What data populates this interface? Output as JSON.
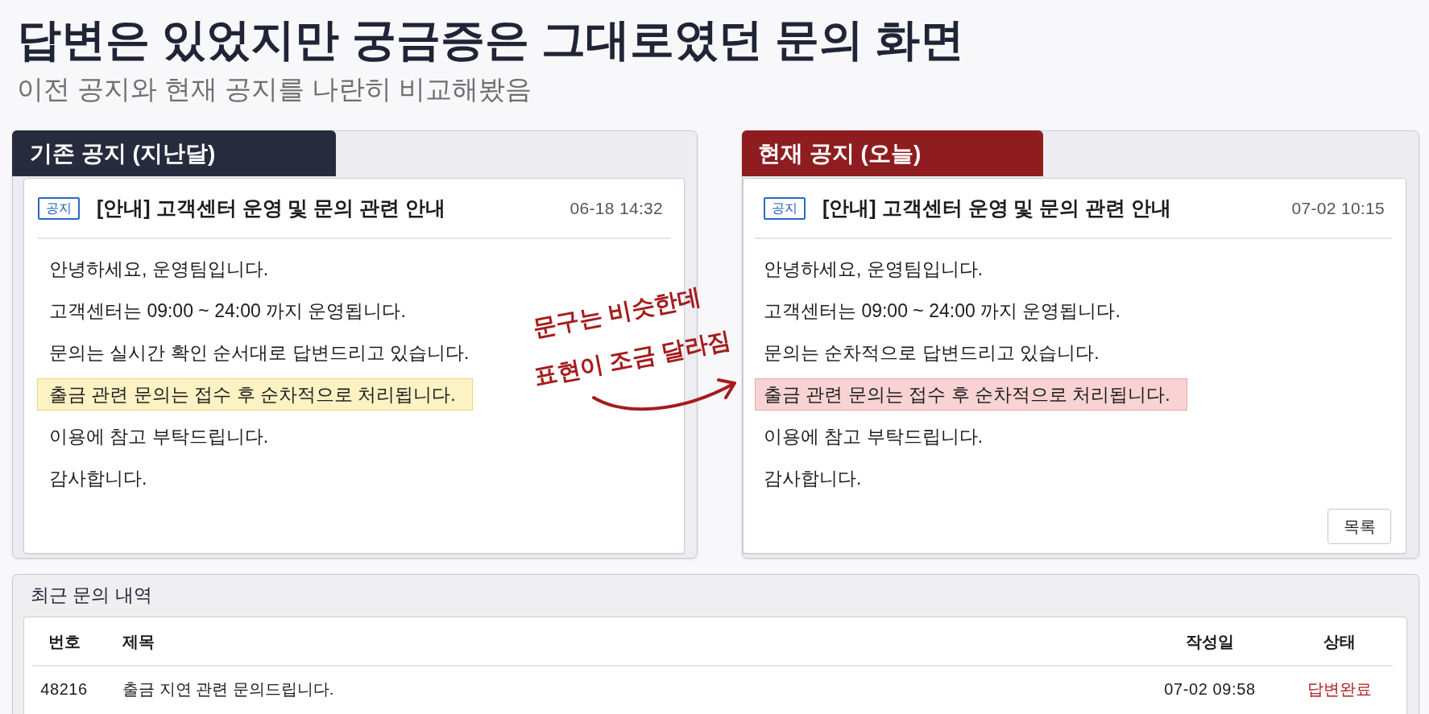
{
  "page": {
    "title": "답변은 있었지만 궁금증은 그대로였던 문의 화면",
    "subtitle": "이전 공지와 현재 공지를 나란히 비교해봤음"
  },
  "notices": [
    {
      "kind": "previous",
      "tab_label": "기존 공지 (지난달)",
      "tag": "공지",
      "title": "[안내] 고객센터 운영 및 문의 관련 안내",
      "date": "06-18 14:32",
      "paragraphs": [
        {
          "text": "안녕하세요, 운영팀입니다.",
          "highlighted": false
        },
        {
          "text": "고객센터는 09:00 ~ 24:00 까지 운영됩니다.",
          "highlighted": false
        },
        {
          "text": "문의는 실시간 확인 순서대로 답변드리고 있습니다.",
          "highlighted": false
        },
        {
          "text": "출금 관련 문의는 접수 후 순차적으로 처리됩니다.",
          "highlighted": true
        },
        {
          "text": "이용에 참고 부탁드립니다.",
          "highlighted": false
        }
      ],
      "closing": "감사합니다."
    },
    {
      "kind": "current",
      "tab_label": "현재 공지 (오늘)",
      "tag": "공지",
      "title": "[안내] 고객센터 운영 및 문의 관련 안내",
      "date": "07-02 10:15",
      "paragraphs": [
        {
          "text": "안녕하세요, 운영팀입니다.",
          "highlighted": false
        },
        {
          "text": "고객센터는 09:00 ~ 24:00 까지 운영됩니다.",
          "highlighted": false
        },
        {
          "text": "문의는 순차적으로 답변드리고 있습니다.",
          "highlighted": false
        },
        {
          "text": "출금 관련 문의는 접수 후 순차적으로 처리됩니다.",
          "highlighted": true
        },
        {
          "text": "이용에 참고 부탁드립니다.",
          "highlighted": false
        }
      ],
      "closing": "감사합니다.",
      "button": "목록"
    }
  ],
  "annotation": {
    "lines": [
      "문구는 비슷한데",
      "표현이 조금 달라짐"
    ]
  },
  "recent_inquiries": {
    "title": "최근 문의 내역",
    "columns": [
      "번호",
      "제목",
      "작성일",
      "상태"
    ],
    "rows": [
      [
        "48216",
        "출금 지연 관련 문의드립니다.",
        "07-02 09:58",
        "답변완료"
      ]
    ]
  }
}
